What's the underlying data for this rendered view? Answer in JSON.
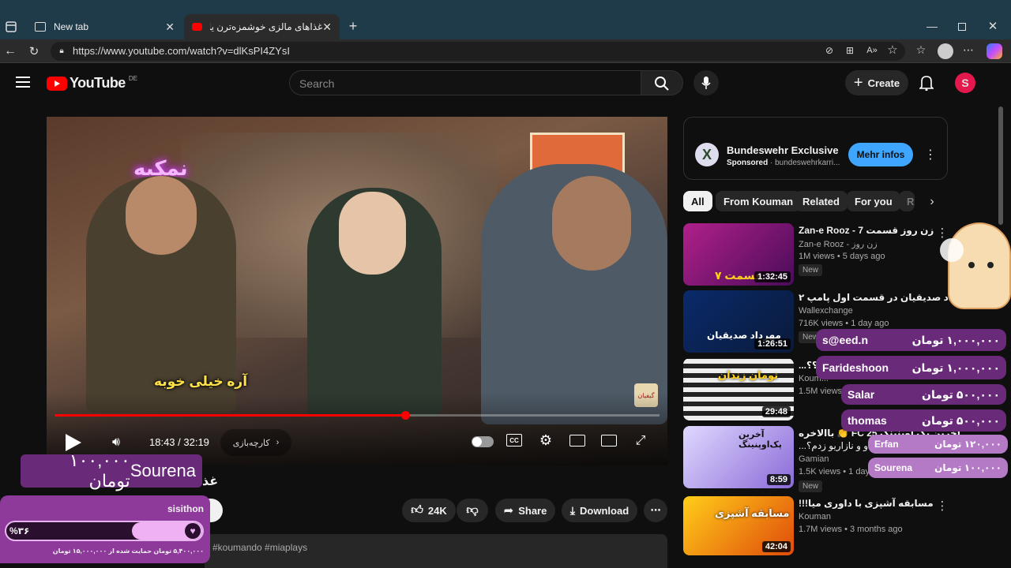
{
  "browser": {
    "tabs": [
      {
        "title": "New tab"
      },
      {
        "title": "غذاهای مالزی خوشمزه‌ترن یا ایران؟؟"
      }
    ],
    "url": "https://www.youtube.com/watch?v=dlKsPI4ZYsI"
  },
  "youtube": {
    "logo_text": "YouTube",
    "region": "DE",
    "search_placeholder": "Search",
    "create_label": "Create",
    "avatar_letter": "S"
  },
  "player": {
    "subtitle": "آره خیلی خوبه",
    "neon_sign": "نمکیه",
    "time": "18:43 / 32:19",
    "chapter": "کارچه‌بازی",
    "progress": 0.58,
    "watermark": "گیفیان",
    "title_partial": "غذ"
  },
  "actions": {
    "likes": "24K",
    "share": "Share",
    "download": "Download"
  },
  "hashtags": "#koumando #miaplays",
  "ad": {
    "logo_letter": "X",
    "title": "Bundeswehr Exclusive",
    "sponsored": "Sponsored",
    "domain": "bundeswehrkarri...",
    "button": "Mehr infos"
  },
  "chips": [
    "All",
    "From Kouman",
    "Related",
    "For you",
    "R"
  ],
  "videos": [
    {
      "title": "Zan-e Rooz - 7 زن روز قسمت",
      "channel": "Zan-e Rooz - زن روز",
      "meta": "1M views • 5 days ago",
      "badge": "New",
      "duration": "1:32:45",
      "thumb_text": "قسمت ۷"
    },
    {
      "title": "مهرداد صدیقیان در قسمت اول پامپ ۲",
      "channel": "Wallexchange",
      "meta": "716K views • 1 day ago",
      "badge": "New",
      "duration": "1:26:51",
      "thumb_text": "مهرداد صدیقیان"
    },
    {
      "title": "...ه؟؟",
      "channel": "Koum...",
      "meta": "1.5M views",
      "badge": "",
      "duration": "29:48",
      "thumb_text": "تومان زندان"
    },
    {
      "title": "باالاخره 👏 FC 25 آخرین پک اوپنینگ",
      "channel": "Gamian",
      "meta": "1.5K views • 1 day a...",
      "badge": "New",
      "duration": "8:59",
      "thumb_text": "آخرین پک‌اوپنینگ",
      "title_line2": "...رونالدو و نازاریو زدم؟!"
    },
    {
      "title": "!!!مسابقه آشپزی با داوری میا",
      "channel": "Kouman",
      "meta": "1.7M views • 3 months ago",
      "badge": "",
      "duration": "42:04",
      "thumb_text": "مسابقه آشپزی"
    }
  ],
  "donations": [
    {
      "name": "s@eed.n",
      "amount": "۱,۰۰۰,۰۰۰ تومان"
    },
    {
      "name": "Farideshoon",
      "amount": "۱,۰۰۰,۰۰۰ تومان"
    },
    {
      "name": "Salar",
      "amount": "۵۰۰,۰۰۰ تومان"
    },
    {
      "name": "thomas",
      "amount": "۵۰۰,۰۰۰ تومان"
    },
    {
      "name": "Erfan",
      "amount": "۱۲۰,۰۰۰ تومان"
    },
    {
      "name": "Sourena",
      "amount": "۱۰۰,۰۰۰ تومان"
    }
  ],
  "alert": {
    "name": "Sourena",
    "amount": "۱۰۰,۰۰۰ تومان"
  },
  "goal": {
    "user": "sisithon",
    "percent": "%۳۶",
    "fraction": 0.36,
    "note": "۵,۴۰۰,۰۰۰ تومان حمایت شده از ۱۵,۰۰۰,۰۰۰ تومان"
  },
  "colors": {
    "accent": "#ff0000",
    "ad_button": "#3ea6ff",
    "donation_bg": "#6a2a7a",
    "goal_bg": "#8e3a9a"
  }
}
